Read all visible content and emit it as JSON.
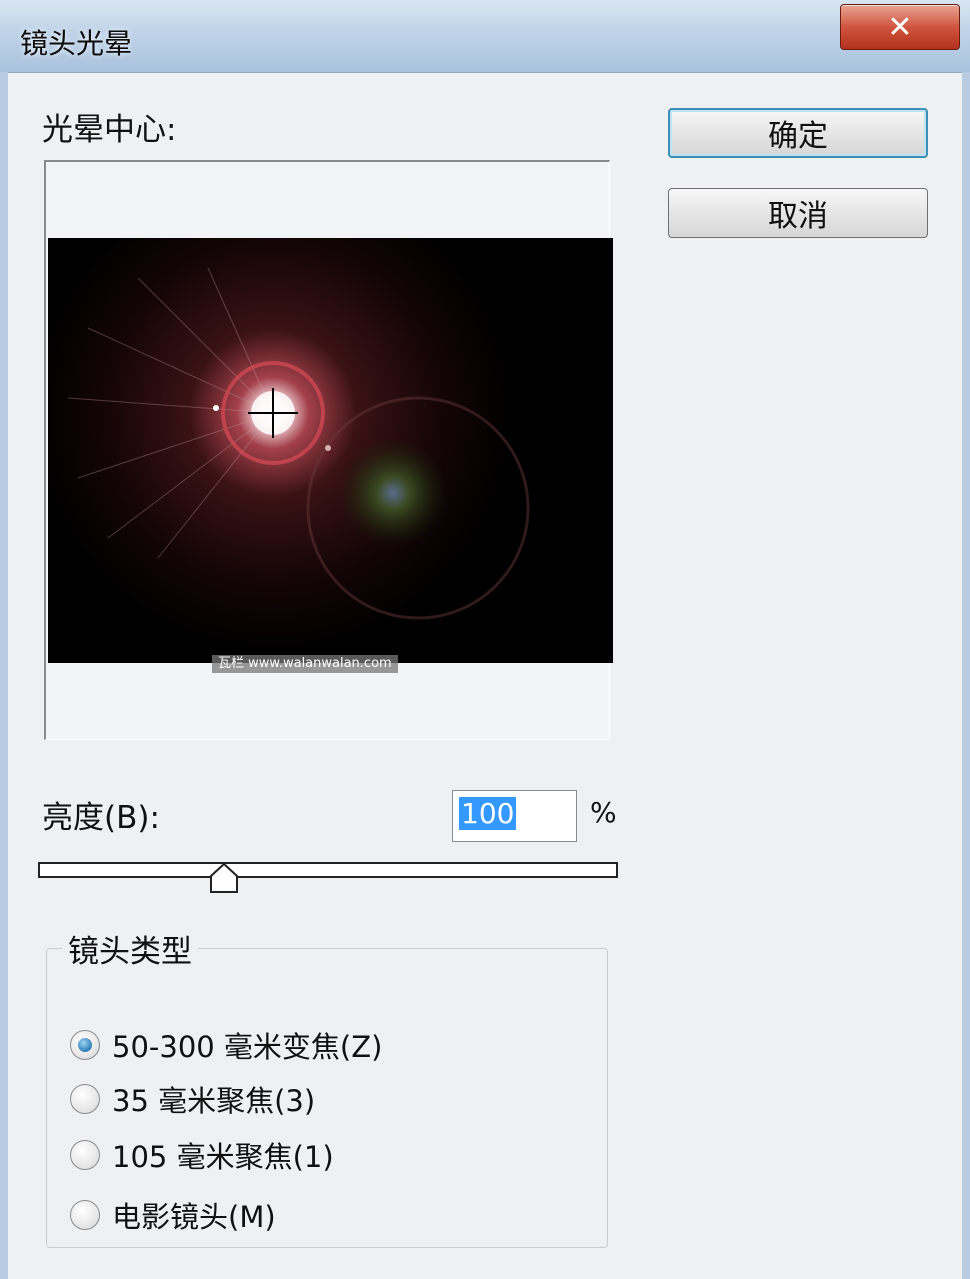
{
  "window": {
    "title": "镜头光晕",
    "close_symbol": "✕"
  },
  "preview": {
    "label": "光晕中心:",
    "watermark": "瓦栏 www.walanwalan.com"
  },
  "buttons": {
    "ok": "确定",
    "cancel": "取消"
  },
  "brightness": {
    "label": "亮度(B):",
    "value": "100",
    "unit": "%",
    "slider_fraction": 0.32
  },
  "lens_type": {
    "title": "镜头类型",
    "options": [
      {
        "label": "50-300 毫米变焦(Z)",
        "checked": true
      },
      {
        "label": "35 毫米聚焦(3)",
        "checked": false
      },
      {
        "label": "105 毫米聚焦(1)",
        "checked": false
      },
      {
        "label": "电影镜头(M)",
        "checked": false
      }
    ]
  },
  "icons": {
    "close": "close-icon",
    "crosshair": "crosshair-icon",
    "slider_thumb": "slider-thumb-icon"
  }
}
